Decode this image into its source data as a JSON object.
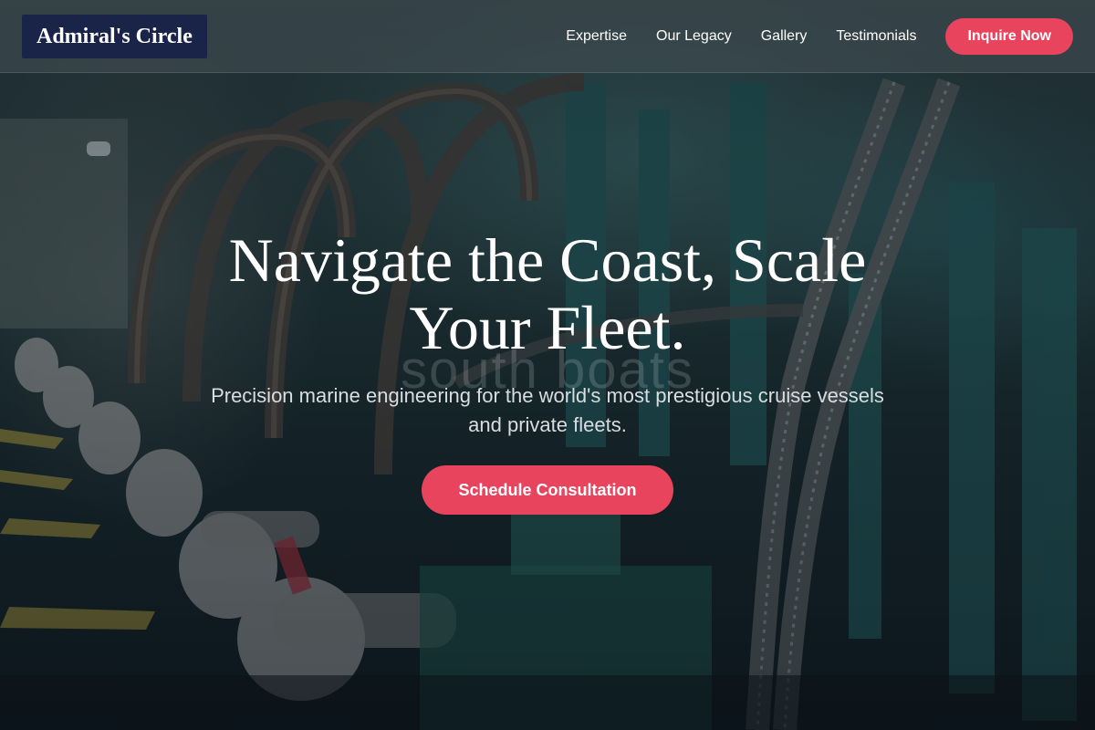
{
  "nav": {
    "logo": "Admiral's Circle",
    "links": [
      "Expertise",
      "Our Legacy",
      "Gallery",
      "Testimonials"
    ],
    "cta_label": "Inquire Now"
  },
  "hero": {
    "title": "Navigate the Coast, Scale Your Fleet.",
    "watermark": "south boats",
    "subtitle": "Precision marine engineering for the world's most prestigious cruise vessels and private fleets.",
    "cta_label": "Schedule Consultation"
  },
  "colors": {
    "accent": "#e8445e",
    "logo_bg": "#1a2448"
  },
  "icons": {
    "background": "engine-room-machinery-image"
  }
}
